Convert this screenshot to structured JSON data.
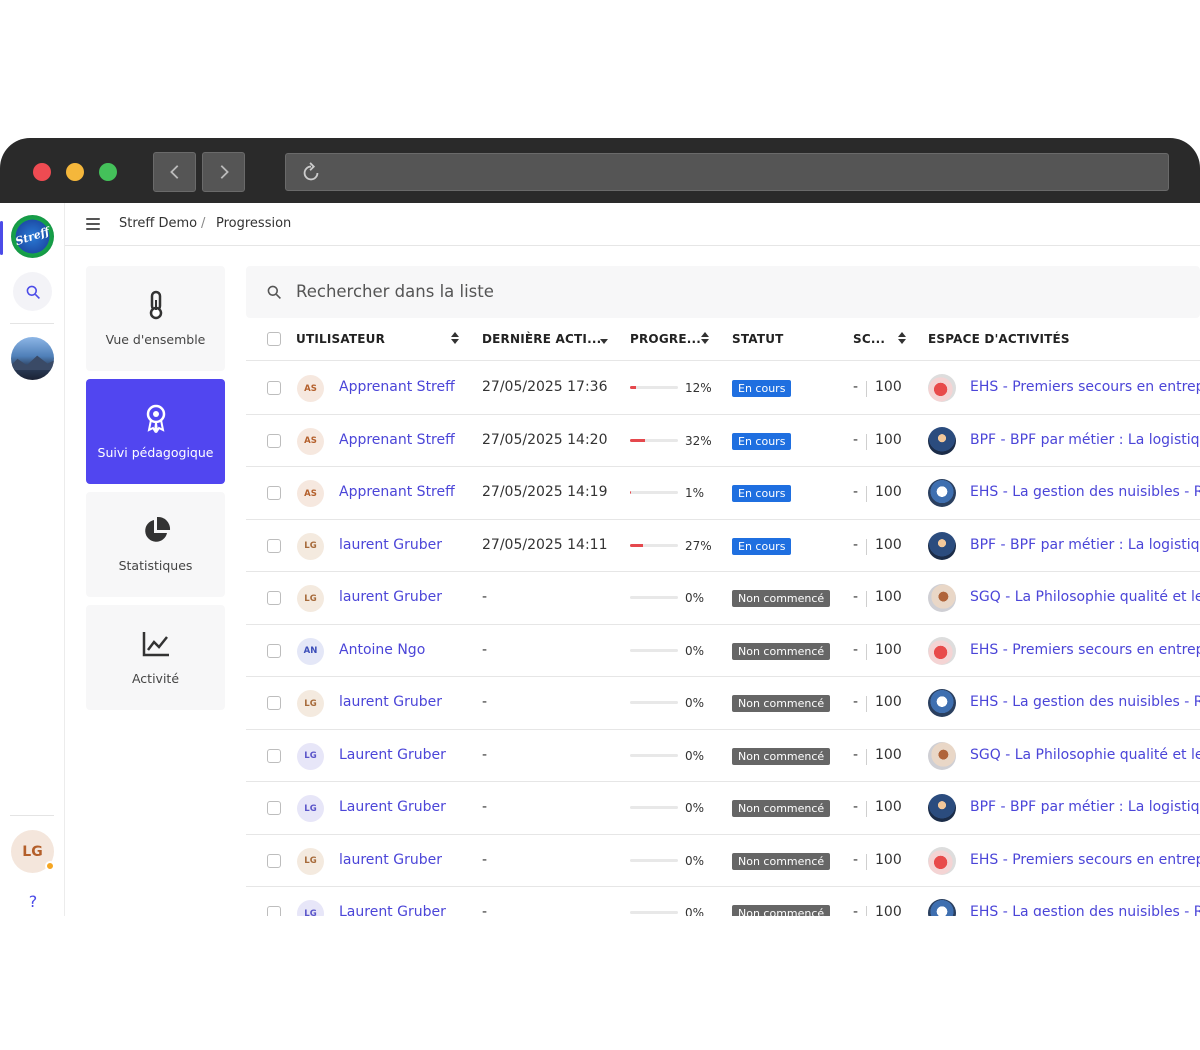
{
  "app": {
    "logo_text": "Streff",
    "user_initials": "LG",
    "help_label": "?"
  },
  "breadcrumb": [
    "Streff Demo",
    "/",
    "Progression"
  ],
  "nav": [
    {
      "label": "Vue d'ensemble",
      "icon": "thermometer-icon",
      "active": false
    },
    {
      "label": "Suivi pédagogique",
      "icon": "award-icon",
      "active": true
    },
    {
      "label": "Statistiques",
      "icon": "pie-chart-icon",
      "active": false
    },
    {
      "label": "Activité",
      "icon": "line-chart-icon",
      "active": false
    }
  ],
  "search": {
    "placeholder": "Rechercher dans la liste"
  },
  "columns": {
    "user": "UTILISATEUR",
    "last_activity": "DERNIÈRE ACTI...",
    "progress": "PROGRE...",
    "status": "STATUT",
    "score": "SC...",
    "space": "ESPACE D'ACTIVITÉS"
  },
  "rows": [
    {
      "initials": "AS",
      "name": "Apprenant Streff",
      "date": "27/05/2025 17:36",
      "progress": 12,
      "progress_label": "12%",
      "status": "En cours",
      "score_min": "-",
      "score_max": "100",
      "space": "EHS - Premiers secours en entreprise"
    },
    {
      "initials": "AS",
      "name": "Apprenant Streff",
      "date": "27/05/2025 14:20",
      "progress": 32,
      "progress_label": "32%",
      "status": "En cours",
      "score_min": "-",
      "score_max": "100",
      "space": "BPF - BPF par métier : La logistique"
    },
    {
      "initials": "AS",
      "name": "Apprenant Streff",
      "date": "27/05/2025 14:19",
      "progress": 1,
      "progress_label": "1%",
      "status": "En cours",
      "score_min": "-",
      "score_max": "100",
      "space": "EHS - La gestion des nuisibles - Risques"
    },
    {
      "initials": "LG",
      "name": "laurent Gruber",
      "date": "27/05/2025 14:11",
      "progress": 27,
      "progress_label": "27%",
      "status": "En cours",
      "score_min": "-",
      "score_max": "100",
      "space": "BPF - BPF par métier : La logistique"
    },
    {
      "initials": "LG",
      "name": "laurent Gruber",
      "date": "-",
      "progress": 0,
      "progress_label": "0%",
      "status": "Non commencé",
      "score_min": "-",
      "score_max": "100",
      "space": "SGQ - La Philosophie qualité et les"
    },
    {
      "initials": "AN",
      "name": "Antoine Ngo",
      "date": "-",
      "progress": 0,
      "progress_label": "0%",
      "status": "Non commencé",
      "score_min": "-",
      "score_max": "100",
      "space": "EHS - Premiers secours en entreprise"
    },
    {
      "initials": "LG",
      "name": "laurent Gruber",
      "date": "-",
      "progress": 0,
      "progress_label": "0%",
      "status": "Non commencé",
      "score_min": "-",
      "score_max": "100",
      "space": "EHS - La gestion des nuisibles - Risques"
    },
    {
      "initials": "LG",
      "name": "Laurent Gruber",
      "date": "-",
      "progress": 0,
      "progress_label": "0%",
      "status": "Non commencé",
      "score_min": "-",
      "score_max": "100",
      "space": "SGQ - La Philosophie qualité et les"
    },
    {
      "initials": "LG",
      "name": "Laurent Gruber",
      "date": "-",
      "progress": 0,
      "progress_label": "0%",
      "status": "Non commencé",
      "score_min": "-",
      "score_max": "100",
      "space": "BPF - BPF par métier : La logistique"
    },
    {
      "initials": "LG",
      "name": "laurent Gruber",
      "date": "-",
      "progress": 0,
      "progress_label": "0%",
      "status": "Non commencé",
      "score_min": "-",
      "score_max": "100",
      "space": "EHS - Premiers secours en entreprise"
    },
    {
      "initials": "LG",
      "name": "Laurent Gruber",
      "date": "-",
      "progress": 0,
      "progress_label": "0%",
      "status": "Non commencé",
      "score_min": "-",
      "score_max": "100",
      "space": "EHS - La gestion des nuisibles - Risques"
    }
  ],
  "colors": {
    "accent": "#5146f0",
    "link": "#4b45d8",
    "status_running": "#1f6fe0",
    "status_not_started": "#666666",
    "progress_fill": "#e5484d"
  }
}
